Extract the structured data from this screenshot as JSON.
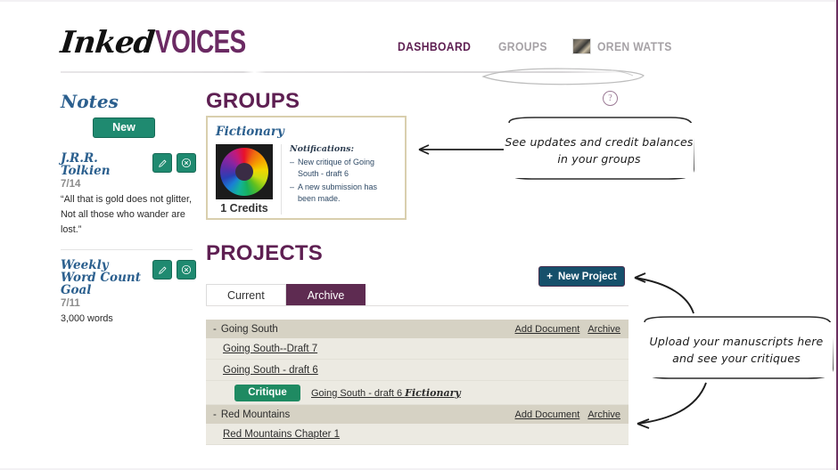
{
  "header": {
    "logo_script": "Inked",
    "logo_bold": "VOICES",
    "nav": [
      {
        "label": "DASHBOARD",
        "state": "active"
      },
      {
        "label": "GROUPS",
        "state": "muted"
      }
    ],
    "user_name": "OREN WATTS"
  },
  "sidebar": {
    "title": "Notes",
    "new_label": "New",
    "notes": [
      {
        "name": "J.R.R. Tolkien",
        "date": "7/14",
        "body": "“All that is gold does not glitter, Not all those who wander are lost.”"
      },
      {
        "name": "Weekly Word Count Goal",
        "date": "7/11",
        "body": "3,000 words"
      }
    ]
  },
  "groups": {
    "title": "GROUPS",
    "help_glyph": "?",
    "card": {
      "name": "Fictionary",
      "credits": "1 Credits",
      "notifications_label": "Notifications:",
      "notifications": [
        "New critique of Going South - draft 6",
        "A new submission has been made."
      ]
    }
  },
  "projects": {
    "title": "PROJECTS",
    "new_project_label": "New Project",
    "new_project_plus": "+",
    "tabs": [
      {
        "label": "Current",
        "state": "active"
      },
      {
        "label": "Archive",
        "state": "inactive"
      }
    ],
    "row_links": {
      "add_document": "Add Document",
      "archive": "Archive"
    },
    "items": [
      {
        "name": "Going South",
        "collapse_glyph": "-",
        "documents": [
          "Going South--Draft 7",
          "Going South - draft 6"
        ],
        "critiques": [
          {
            "button": "Critique",
            "doc": "Going South - draft 6 ",
            "group": "Fictionary"
          }
        ]
      },
      {
        "name": "Red Mountains",
        "collapse_glyph": "-",
        "documents": [
          "Red Mountains Chapter 1"
        ],
        "critiques": []
      }
    ]
  },
  "annotations": [
    {
      "id": "groups",
      "text": "See updates and credit balances in your groups"
    },
    {
      "id": "projects",
      "text": "Upload your manuscripts here and see your critiques"
    }
  ],
  "colors": {
    "brand_purple": "#5e1f52",
    "accent_teal": "#1f8a70",
    "accent_green": "#1f8a62",
    "button_dark_teal": "#16506b",
    "tab_purple": "#5e2b51",
    "link_blue": "#2b5f8e",
    "row_beige": "#d6d2c4"
  }
}
